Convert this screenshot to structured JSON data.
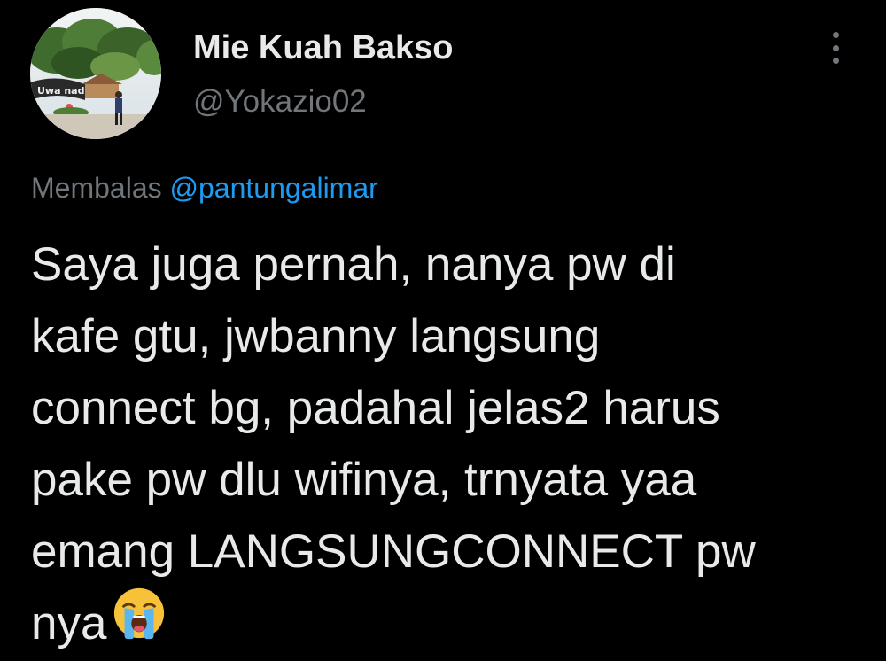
{
  "author": {
    "display_name": "Mie Kuah Bakso",
    "handle": "@Yokazio02",
    "avatar_sign_text": "Uwa nada"
  },
  "more_icon": "more-vertical-icon",
  "reply": {
    "prefix": "Membalas",
    "mention": "@pantungalimar"
  },
  "tweet": {
    "lines": [
      "Saya juga pernah, nanya pw di",
      "kafe gtu, jwbanny langsung",
      "connect bg, padahal jelas2 harus",
      "pake pw dlu wifinya, trnyata yaa",
      "emang LANGSUNGCONNECT pw",
      "nya"
    ],
    "emoji": "loudly-crying-face-icon"
  },
  "colors": {
    "background": "#000000",
    "text_primary": "#e7e9ea",
    "text_secondary": "#71767b",
    "link": "#1d9bf0"
  }
}
